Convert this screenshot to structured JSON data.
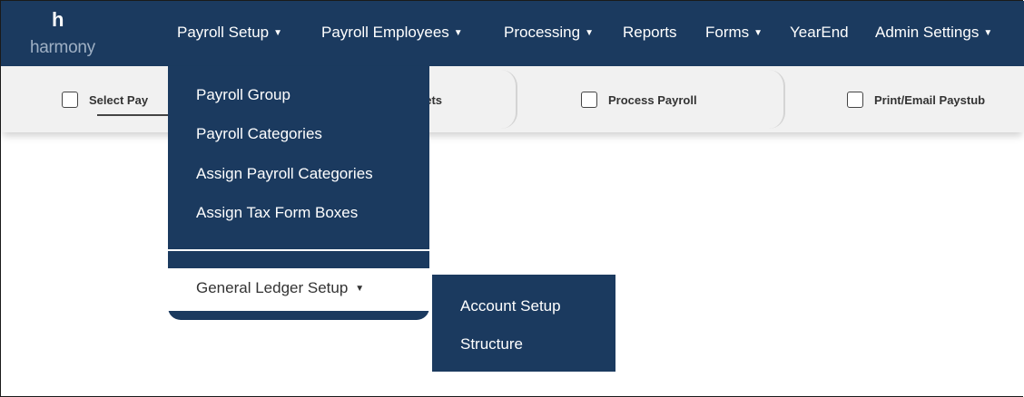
{
  "brand": {
    "initial": "h",
    "wordmark": "harmony"
  },
  "nav": {
    "items": [
      {
        "label": "Payroll Setup",
        "caret": "▼"
      },
      {
        "label": "Payroll Employees",
        "caret": "▼"
      },
      {
        "label": "Processing",
        "caret": "▼"
      },
      {
        "label": "Reports",
        "caret": ""
      },
      {
        "label": "Forms",
        "caret": "▼"
      },
      {
        "label": "YearEnd",
        "caret": ""
      },
      {
        "label": "Admin Settings",
        "caret": "▼"
      }
    ]
  },
  "steps": [
    {
      "label": "Select Pay"
    },
    {
      "label": "eets"
    },
    {
      "label": "Process Payroll"
    },
    {
      "label": "Print/Email Paystub"
    }
  ],
  "dropdown": {
    "items": [
      {
        "label": "Payroll Group"
      },
      {
        "label": "Payroll Categories"
      },
      {
        "label": "Assign Payroll Categories"
      },
      {
        "label": "Assign Tax Form Boxes"
      }
    ],
    "general_ledger": {
      "label": "General Ledger Setup",
      "caret": "▼"
    }
  },
  "submenu": {
    "items": [
      {
        "label": "Account Setup"
      },
      {
        "label": "Structure"
      }
    ]
  },
  "colors": {
    "navy": "#1b3a5f",
    "stepbar_bg": "#f1f1f1"
  }
}
